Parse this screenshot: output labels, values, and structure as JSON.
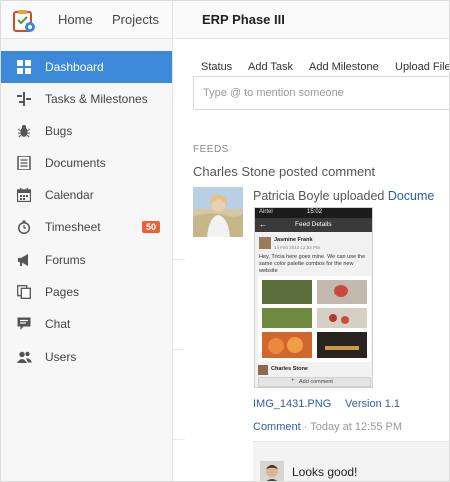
{
  "topbar": {
    "nav": [
      {
        "label": "Home"
      },
      {
        "label": "Projects"
      }
    ],
    "project_title": "ERP Phase III"
  },
  "sidebar": {
    "items": [
      {
        "label": "Dashboard",
        "icon": "dashboard-grid-icon",
        "active": true
      },
      {
        "label": "Tasks & Milestones",
        "icon": "tasks-milestones-icon"
      },
      {
        "label": "Bugs",
        "icon": "bug-icon"
      },
      {
        "label": "Documents",
        "icon": "documents-icon"
      },
      {
        "label": "Calendar",
        "icon": "calendar-icon"
      },
      {
        "label": "Timesheet",
        "icon": "stopwatch-icon",
        "badge": "50"
      },
      {
        "label": "Forums",
        "icon": "megaphone-icon"
      },
      {
        "label": "Pages",
        "icon": "pages-icon"
      },
      {
        "label": "Chat",
        "icon": "chat-icon"
      },
      {
        "label": "Users",
        "icon": "users-icon"
      }
    ]
  },
  "main": {
    "tabs": [
      {
        "label": "Status"
      },
      {
        "label": "Add Task"
      },
      {
        "label": "Add Milestone"
      },
      {
        "label": "Upload File"
      }
    ],
    "composer": {
      "placeholder": "Type @ to mention someone"
    },
    "feeds": {
      "section_label": "FEEDS",
      "headline": "Charles Stone posted comment",
      "upload": {
        "user": "Patricia Boyle",
        "action": " uploaded ",
        "link": "Docume"
      },
      "screenshot": {
        "carrier": "Airtel",
        "time": "15:02",
        "title": "Feed Details",
        "author": "Jasmine Frank",
        "date": "14 Feb 2013 12:53 PM",
        "message": "Hey, Tricia here goes mine. We can use the same color palette combos for the new website",
        "footer_user": "Charles Stone",
        "add_comment": "Add comment"
      },
      "file": {
        "name": "IMG_1431.PNG",
        "version": "Version 1.1"
      },
      "meta": {
        "comment_link": "Comment",
        "separator": " · ",
        "timestamp": "Today at 12:55 PM"
      },
      "comment": {
        "text": "Looks good!"
      }
    }
  },
  "colors": {
    "accent": "#3c88d9",
    "link": "#2a5ea8",
    "badge": "#e8623c"
  }
}
